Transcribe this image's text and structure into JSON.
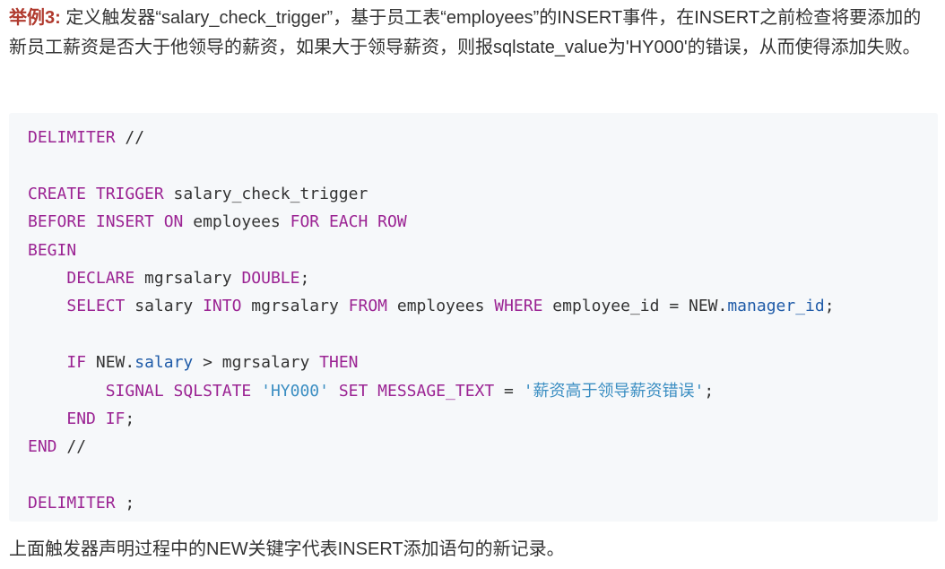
{
  "intro": {
    "label": "举例3:",
    "text": " 定义触发器“salary_check_trigger”，基于员工表“employees”的INSERT事件，在INSERT之前检查将要添加的新员工薪资是否大于他领导的薪资，如果大于领导薪资，则报sqlstate_value为'HY000'的错误，从而使得添加失败。"
  },
  "code": {
    "l1_a": "DELIMITER",
    "l1_b": " //",
    "l3_a": "CREATE TRIGGER",
    "l3_b": " salary_check_trigger",
    "l4_a": "BEFORE INSERT ON",
    "l4_b": " employees ",
    "l4_c": "FOR EACH ROW",
    "l5_a": "BEGIN",
    "l6_indent": "    ",
    "l6_a": "DECLARE",
    "l6_b": " mgrsalary ",
    "l6_c": "DOUBLE",
    "l6_d": ";",
    "l7_indent": "    ",
    "l7_a": "SELECT",
    "l7_b": " salary ",
    "l7_c": "INTO",
    "l7_d": " mgrsalary ",
    "l7_e": "FROM",
    "l7_f": " employees ",
    "l7_g": "WHERE",
    "l7_h": " employee_id = NEW.",
    "l7_i": "manager_id",
    "l7_j": ";",
    "l9_indent": "    ",
    "l9_a": "IF",
    "l9_b": " NEW.",
    "l9_c": "salary",
    "l9_d": " > mgrsalary ",
    "l9_e": "THEN",
    "l10_indent": "        ",
    "l10_a": "SIGNAL SQLSTATE",
    "l10_b": " ",
    "l10_c": "'HY000'",
    "l10_d": " ",
    "l10_e": "SET MESSAGE_TEXT",
    "l10_f": " = ",
    "l10_g": "'薪资高于领导薪资错误'",
    "l10_h": ";",
    "l11_indent": "    ",
    "l11_a": "END IF",
    "l11_b": ";",
    "l12_a": "END",
    "l12_b": " //",
    "l14_a": "DELIMITER",
    "l14_b": " ;"
  },
  "outro": {
    "text": "上面触发器声明过程中的NEW关键字代表INSERT添加语句的新记录。"
  },
  "colors": {
    "keyword": "#9b2393",
    "string": "#3b8ec2",
    "field": "#1f5ba8",
    "label": "#b03a2e",
    "code_background": "#f6f8fa"
  }
}
